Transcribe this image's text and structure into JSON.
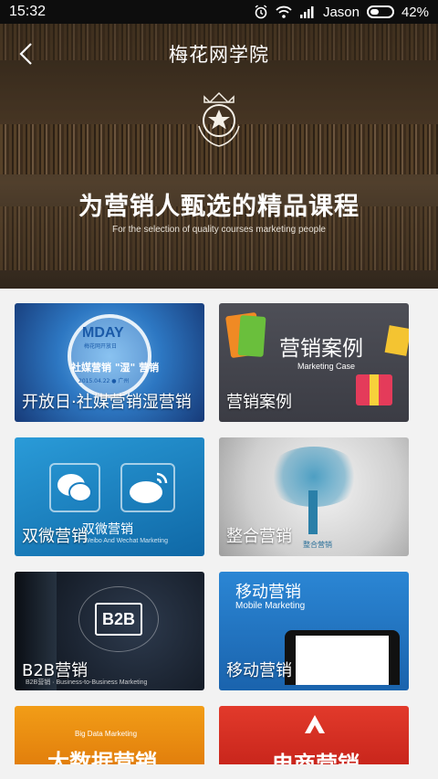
{
  "status_bar": {
    "time": "15:32",
    "carrier": "Jason",
    "battery_percent": "42%",
    "battery_level": 0.42,
    "icons": [
      "alarm-icon",
      "wifi-icon",
      "signal-icon",
      "battery-icon"
    ]
  },
  "header": {
    "title": "梅花网学院",
    "back_icon": "chevron-left-icon"
  },
  "banner": {
    "emblem_icon": "star-crest-icon",
    "slogan": "为营销人甄选的精品课程",
    "slogan_en": "For the selection of quality courses marketing people"
  },
  "courses": [
    {
      "label": "开放日·社媒营销湿营销",
      "art": {
        "brand": "MDAY",
        "brand_sub": "梅花网开放日",
        "headline": "社媒营销 \"湿\" 营销",
        "date": "2015.04.22 ● 广州"
      }
    },
    {
      "label": "营销案例",
      "art": {
        "title": "营销案例",
        "subtitle": "Marketing Case"
      }
    },
    {
      "label": "双微营销",
      "art": {
        "title": "双微营销",
        "subtitle": "Weibo And Wechat Marketing"
      }
    },
    {
      "label": "整合营销",
      "art": {
        "caption": "整合营销"
      }
    },
    {
      "label": "B2B营销",
      "art": {
        "badge": "B2B",
        "subtitle": "B2B营销 · Business-to-Business Marketing"
      }
    },
    {
      "label": "移动营销",
      "art": {
        "title": "移动营销",
        "subtitle": "Mobile Marketing"
      }
    },
    {
      "label": "",
      "art": {
        "subtitle": "Big Data Marketing",
        "title": "大数据营销"
      }
    },
    {
      "label": "",
      "art": {
        "title": "电商营销"
      }
    }
  ],
  "colors": {
    "page_background": "#f2f2f2",
    "status_bar": "#0d0d0d",
    "card_text": "#ffffff"
  }
}
